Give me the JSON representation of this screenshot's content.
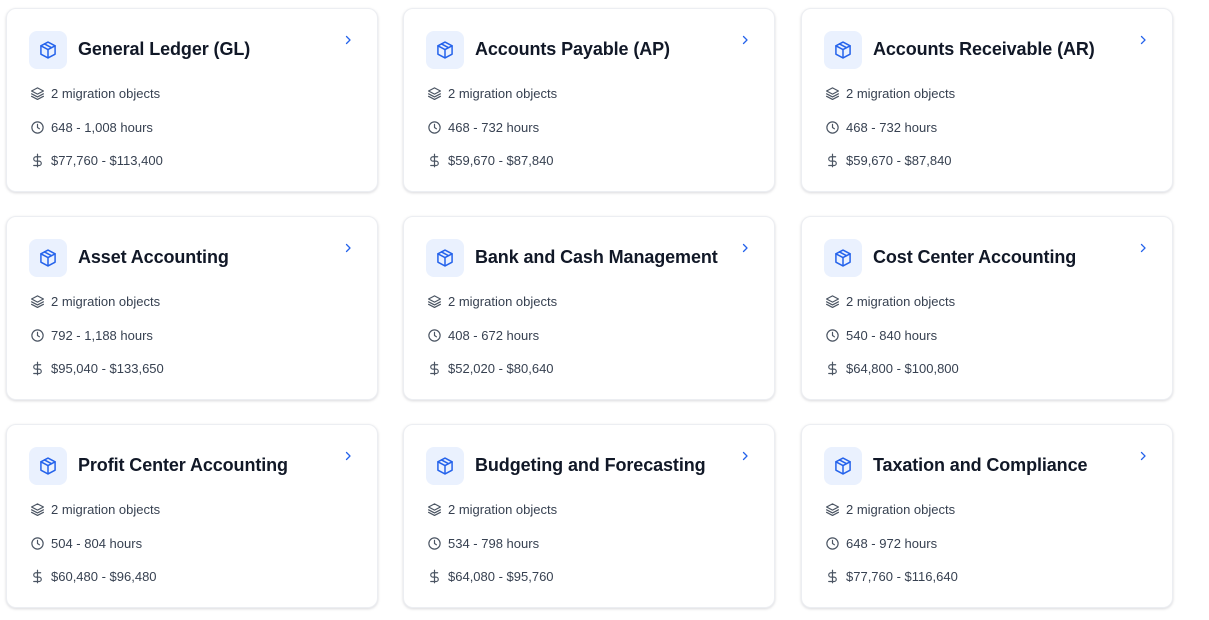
{
  "colors": {
    "accent": "#2563eb",
    "icon_bg": "#eaf1fe",
    "title": "#111827",
    "meta_text": "#374151",
    "meta_icon": "#4b5563"
  },
  "icons": {
    "module": "package-icon",
    "objects": "layers-icon",
    "hours": "clock-icon",
    "cost": "dollar-icon",
    "open": "chevron-right-icon"
  },
  "modules": [
    {
      "title": "General Ledger (GL)",
      "objects": "2 migration objects",
      "hours": "648 - 1,008 hours",
      "cost": "$77,760 - $113,400"
    },
    {
      "title": "Accounts Payable (AP)",
      "objects": "2 migration objects",
      "hours": "468 - 732 hours",
      "cost": "$59,670 - $87,840"
    },
    {
      "title": "Accounts Receivable (AR)",
      "objects": "2 migration objects",
      "hours": "468 - 732 hours",
      "cost": "$59,670 - $87,840"
    },
    {
      "title": "Asset Accounting",
      "objects": "2 migration objects",
      "hours": "792 - 1,188 hours",
      "cost": "$95,040 - $133,650"
    },
    {
      "title": "Bank and Cash Management",
      "objects": "2 migration objects",
      "hours": "408 - 672 hours",
      "cost": "$52,020 - $80,640"
    },
    {
      "title": "Cost Center Accounting",
      "objects": "2 migration objects",
      "hours": "540 - 840 hours",
      "cost": "$64,800 - $100,800"
    },
    {
      "title": "Profit Center Accounting",
      "objects": "2 migration objects",
      "hours": "504 - 804 hours",
      "cost": "$60,480 - $96,480"
    },
    {
      "title": "Budgeting and Forecasting",
      "objects": "2 migration objects",
      "hours": "534 - 798 hours",
      "cost": "$64,080 - $95,760"
    },
    {
      "title": "Taxation and Compliance",
      "objects": "2 migration objects",
      "hours": "648 - 972 hours",
      "cost": "$77,760 - $116,640"
    }
  ]
}
